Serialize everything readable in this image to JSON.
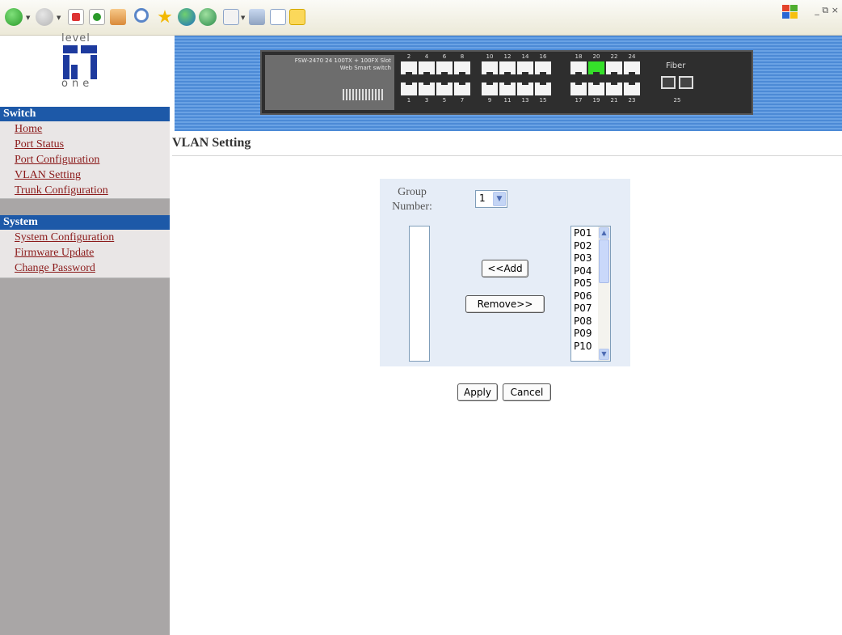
{
  "browser": {
    "window_controls": "_ ⧉ ×"
  },
  "sidebar": {
    "logo_top": "level",
    "logo_bottom": "one",
    "sections": [
      {
        "title": "Switch",
        "items": [
          "Home",
          "Port Status",
          "Port Configuration",
          "VLAN Setting",
          "Trunk Configuration"
        ]
      },
      {
        "title": "System",
        "items": [
          "System Configuration",
          "Firmware Update",
          "Change Password"
        ]
      }
    ]
  },
  "banner": {
    "model_line1": "FSW-2470  24 100TX + 100FX Slot",
    "model_line2": "Web Smart switch",
    "top_port_numbers": [
      "2",
      "4",
      "6",
      "8",
      "10",
      "12",
      "14",
      "16",
      "18",
      "20",
      "22",
      "24"
    ],
    "bottom_port_numbers": [
      "1",
      "3",
      "5",
      "7",
      "9",
      "11",
      "13",
      "15",
      "17",
      "19",
      "21",
      "23"
    ],
    "fiber_label": "Fiber",
    "fiber_number": "25",
    "active_port": "20"
  },
  "main": {
    "title": "VLAN Setting",
    "group_number_label": "Group Number:",
    "group_number_value": "1",
    "add_label": "<<Add",
    "remove_label": "Remove>>",
    "ports": [
      "P01",
      "P02",
      "P03",
      "P04",
      "P05",
      "P06",
      "P07",
      "P08",
      "P09",
      "P10"
    ],
    "apply_label": "Apply",
    "cancel_label": "Cancel"
  },
  "colors": {
    "sidebar_bg": "#a9a6a6",
    "section_header": "#1d59a8",
    "link": "#8b1a1a",
    "banner": "#4c8ad6",
    "active_port": "#35e02a"
  }
}
